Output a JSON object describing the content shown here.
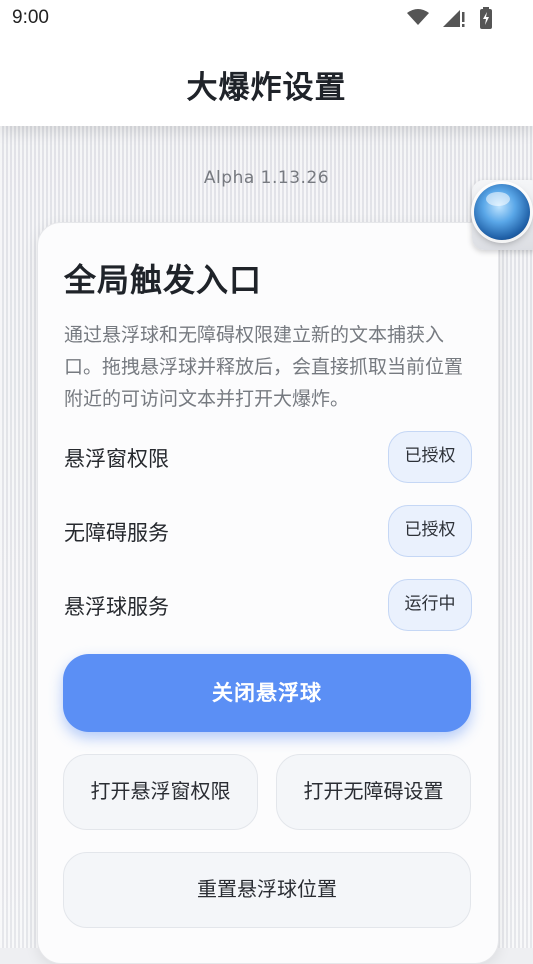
{
  "status_bar": {
    "time": "9:00",
    "icons": [
      "wifi-icon",
      "signal-icon",
      "battery-icon"
    ]
  },
  "header": {
    "title": "大爆炸设置"
  },
  "version": "Alpha 1.13.26",
  "card": {
    "title": "全局触发入口",
    "description": "通过悬浮球和无障碍权限建立新的文本捕获入口。拖拽悬浮球并释放后，会直接抓取当前位置附近的可访问文本并打开大爆炸。",
    "permissions": [
      {
        "label": "悬浮窗权限",
        "status": "已授权"
      },
      {
        "label": "无障碍服务",
        "status": "已授权"
      },
      {
        "label": "悬浮球服务",
        "status": "运行中"
      }
    ],
    "primary_button": "关闭悬浮球",
    "open_overlay_button": "打开悬浮窗权限",
    "open_accessibility_button": "打开无障碍设置",
    "reset_button": "重置悬浮球位置"
  },
  "colors": {
    "accent": "#5b8ff5",
    "badge_bg": "#eaf1fd",
    "badge_border": "#c5d7f5"
  }
}
